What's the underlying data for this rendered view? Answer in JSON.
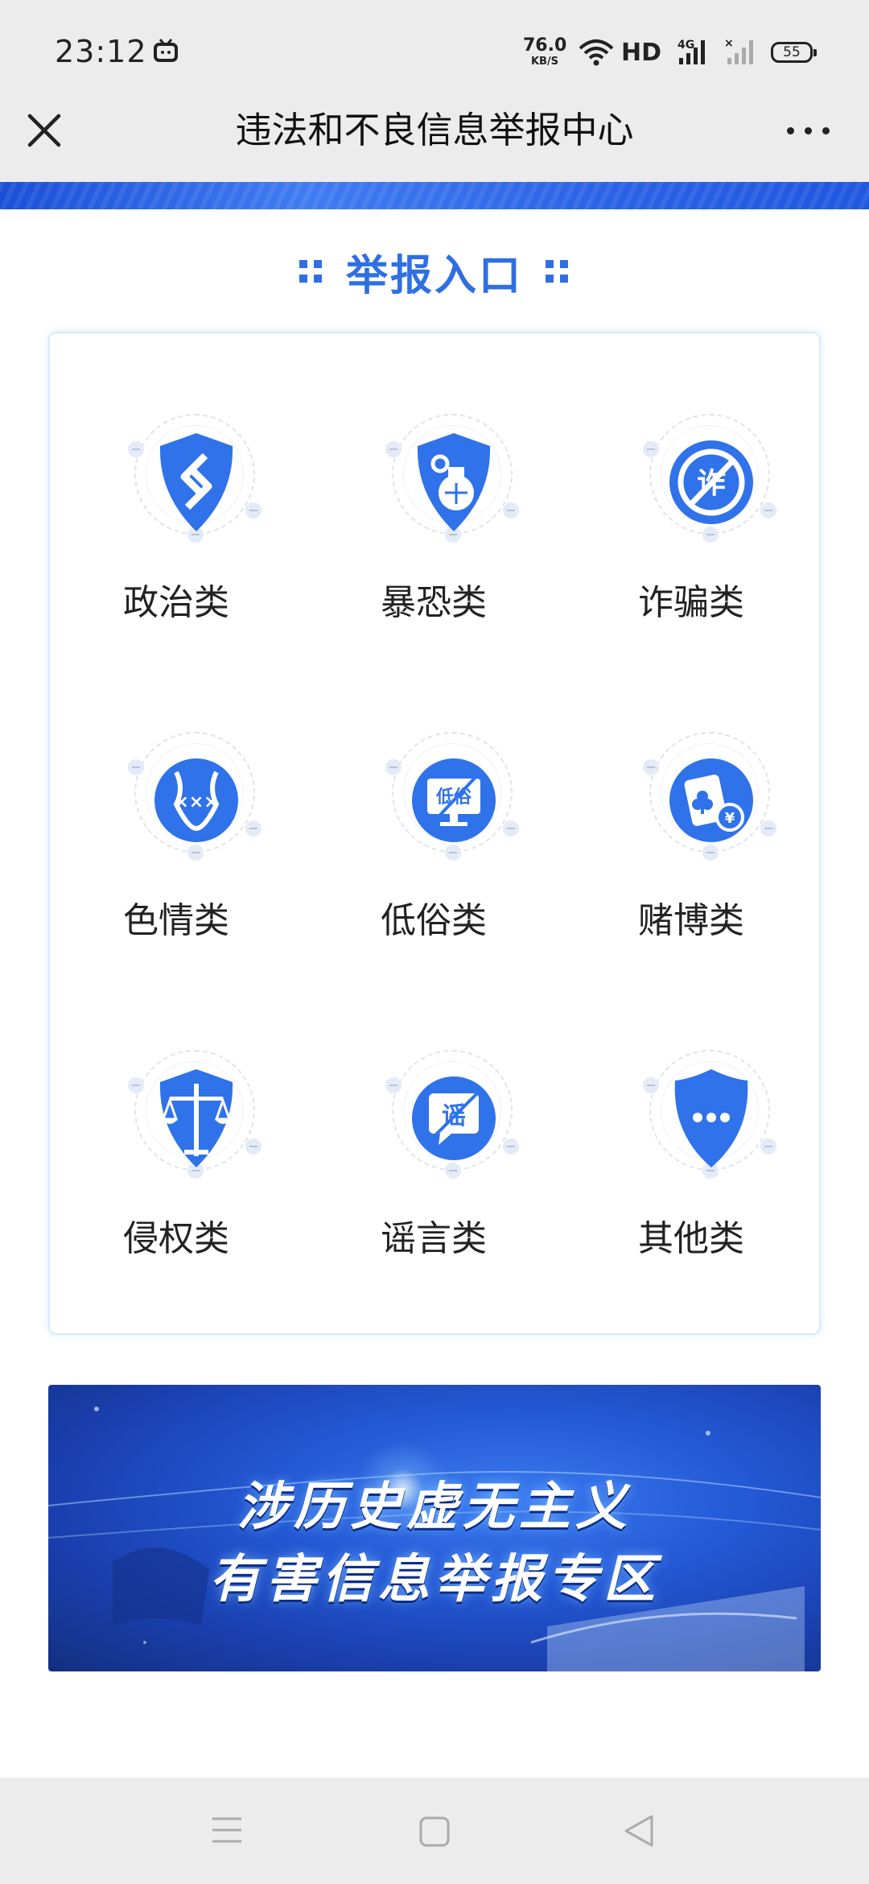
{
  "status_bar": {
    "time": "23:12",
    "net_speed_value": "76.0",
    "net_speed_unit": "KB/S",
    "hd_label": "HD",
    "network_type": "4G",
    "battery": "55"
  },
  "header": {
    "title": "违法和不良信息举报中心"
  },
  "section": {
    "title": "举报入口"
  },
  "categories": [
    {
      "label": "政治类",
      "icon": "political-shield-icon"
    },
    {
      "label": "暴恐类",
      "icon": "grenade-shield-icon"
    },
    {
      "label": "诈骗类",
      "icon": "no-fraud-icon"
    },
    {
      "label": "色情类",
      "icon": "adult-content-icon"
    },
    {
      "label": "低俗类",
      "icon": "vulgar-monitor-icon"
    },
    {
      "label": "赌博类",
      "icon": "gambling-card-icon"
    },
    {
      "label": "侵权类",
      "icon": "scales-shield-icon"
    },
    {
      "label": "谣言类",
      "icon": "rumor-chat-icon"
    },
    {
      "label": "其他类",
      "icon": "other-shield-icon"
    }
  ],
  "promo_banner": {
    "line1": "涉历史虚无主义",
    "line2": "有害信息举报专区"
  },
  "colors": {
    "accent": "#2f6fe3",
    "icon_blue": "#2f72ea"
  }
}
